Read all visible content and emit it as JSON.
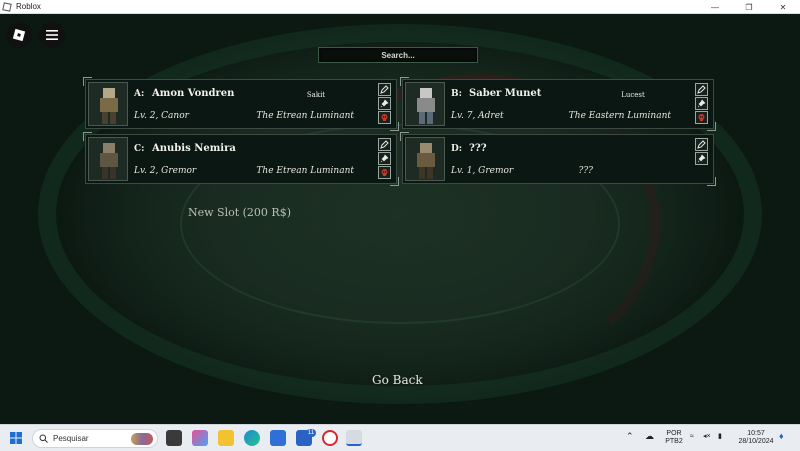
{
  "window": {
    "title": "Roblox",
    "minimize_icon": "minimize-icon",
    "maximize_icon": "maximize-icon",
    "close_icon": "close-icon"
  },
  "search": {
    "placeholder": "Search..."
  },
  "slots": [
    {
      "letter": "A:",
      "name": "Amon Vondren",
      "tag": "Sakit",
      "level": "Lv. 2, Canor",
      "origin": "The Etrean Luminant",
      "has_delete": true
    },
    {
      "letter": "B:",
      "name": "Saber Munet",
      "tag": "Lucest",
      "level": "Lv. 7, Adret",
      "origin": "The Eastern Luminant",
      "has_delete": true
    },
    {
      "letter": "C:",
      "name": "Anubis Nemira",
      "tag": "",
      "level": "Lv. 2, Gremor",
      "origin": "The Etrean Luminant",
      "has_delete": true
    },
    {
      "letter": "D:",
      "name": "???",
      "tag": "",
      "level": "Lv. 1, Gremor",
      "origin": "???",
      "has_delete": false
    }
  ],
  "new_slot": "New Slot (200 R$)",
  "go_back": "Go Back",
  "taskbar": {
    "search_placeholder": "Pesquisar",
    "notification_count": "11",
    "language": "POR",
    "layout": "PTB2",
    "time": "10:57",
    "date": "28/10/2024"
  },
  "colors": {
    "panel_bg": "#0a1712",
    "text": "#f0efe6",
    "accent_blue": "#2b63c4"
  }
}
